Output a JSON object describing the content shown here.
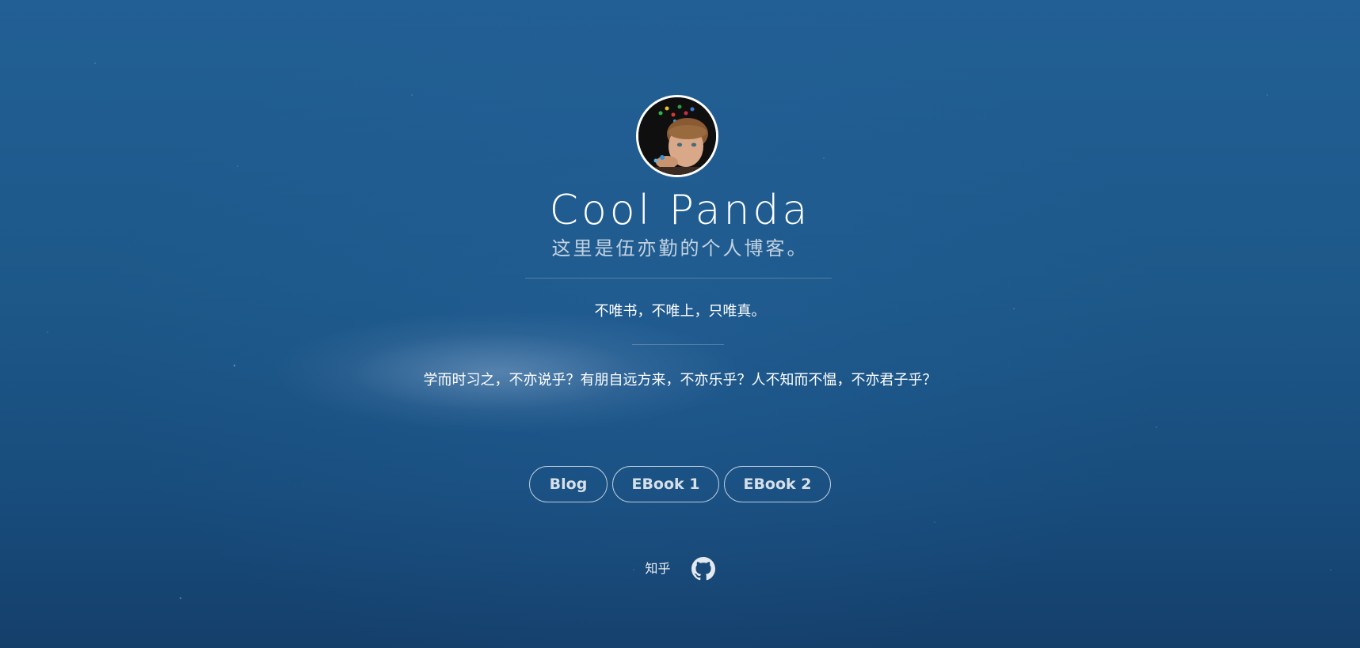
{
  "header": {
    "title": "Cool Panda",
    "subtitle": "这里是伍亦勤的个人博客。"
  },
  "motto": "不唯书，不唯上，只唯真。",
  "quote": "学而时习之，不亦说乎？有朋自远方来，不亦乐乎？人不知而不愠，不亦君子乎？",
  "buttons": {
    "blog": "Blog",
    "ebook1": "EBook 1",
    "ebook2": "EBook 2"
  },
  "social": {
    "zhihu": "知乎",
    "github_icon": "github-icon"
  },
  "colors": {
    "background_top": "#225f94",
    "background_bottom": "#153f6b",
    "text": "#ffffff"
  }
}
